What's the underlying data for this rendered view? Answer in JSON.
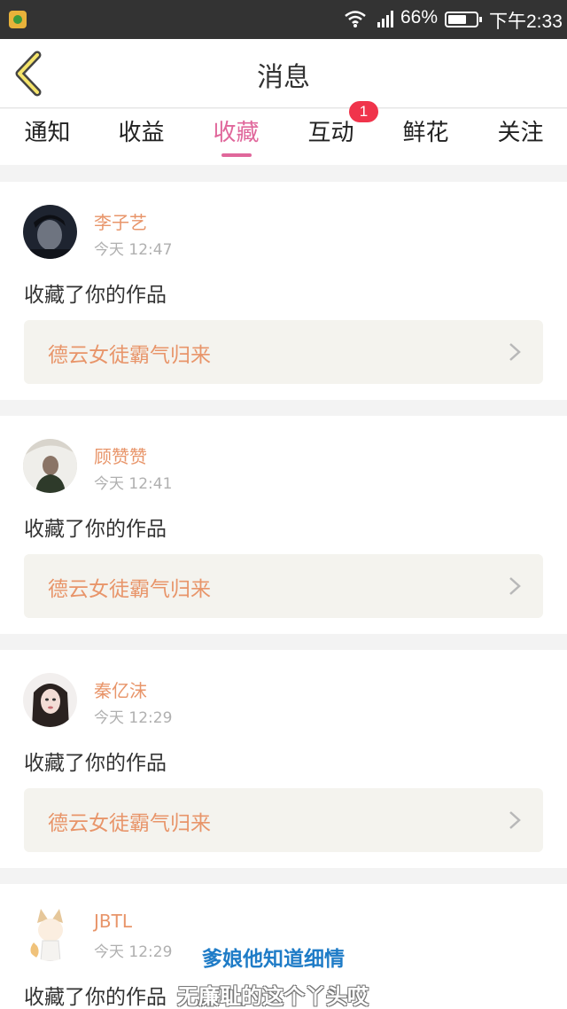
{
  "status_bar": {
    "battery_pct": "66%",
    "battery_level": 0.66,
    "time": "下午2:33"
  },
  "header": {
    "title": "消息"
  },
  "tabs": [
    {
      "label": "通知"
    },
    {
      "label": "收益"
    },
    {
      "label": "收藏"
    },
    {
      "label": "互动",
      "badge": "1"
    },
    {
      "label": "鲜花"
    },
    {
      "label": "关注"
    }
  ],
  "active_tab": "收藏",
  "messages": [
    {
      "name": "李子艺",
      "time": "今天 12:47",
      "action": "收藏了你的作品",
      "work": "德云女徒霸气归来"
    },
    {
      "name": "顾赞赞",
      "time": "今天 12:41",
      "action": "收藏了你的作品",
      "work": "德云女徒霸气归来"
    },
    {
      "name": "秦亿沫",
      "time": "今天 12:29",
      "action": "收藏了你的作品",
      "work": "德云女徒霸气归来"
    },
    {
      "name": "JBTL",
      "time": "今天 12:29",
      "action": "收藏了你的作品",
      "work": ""
    }
  ],
  "subtitles": {
    "line1": "爹娘他知道细情",
    "line2": "无廉耻的这个丫头哎"
  },
  "colors": {
    "accent": "#e0679b",
    "name": "#e8956a",
    "badge": "#f0344b"
  }
}
